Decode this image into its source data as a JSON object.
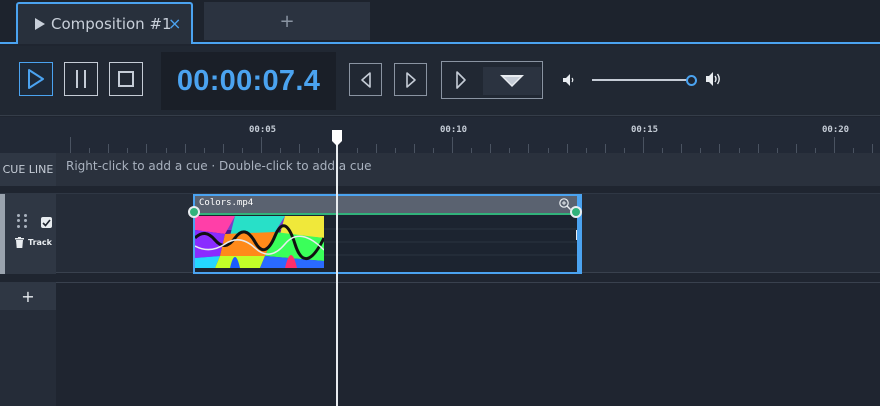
{
  "tabs": {
    "active_label": "Composition #1",
    "close_glyph": "×",
    "add_glyph": "+"
  },
  "transport": {
    "timecode": "00:00:07.4",
    "buttons": [
      "play-icon",
      "pause-icon",
      "stop-icon",
      "previous-frame-icon",
      "next-frame-icon",
      "play-mode-icon",
      "dropdown-icon"
    ],
    "volume_fraction": 0.94
  },
  "ruler": {
    "ticks": [
      "00:05",
      "00:10",
      "00:15",
      "00:20"
    ]
  },
  "cue_line": {
    "label": "CUE LINE",
    "hint": "Right-click to add a cue · Double-click to add a cue"
  },
  "track": {
    "name": "Track",
    "enabled": true,
    "clip": {
      "title": "Colors.mp4"
    }
  },
  "add_track": "+",
  "colors": {
    "accent": "#4ba3f0",
    "fade": "#32b27b",
    "background": "#1f2530"
  },
  "playhead_time": "00:00:07.4"
}
